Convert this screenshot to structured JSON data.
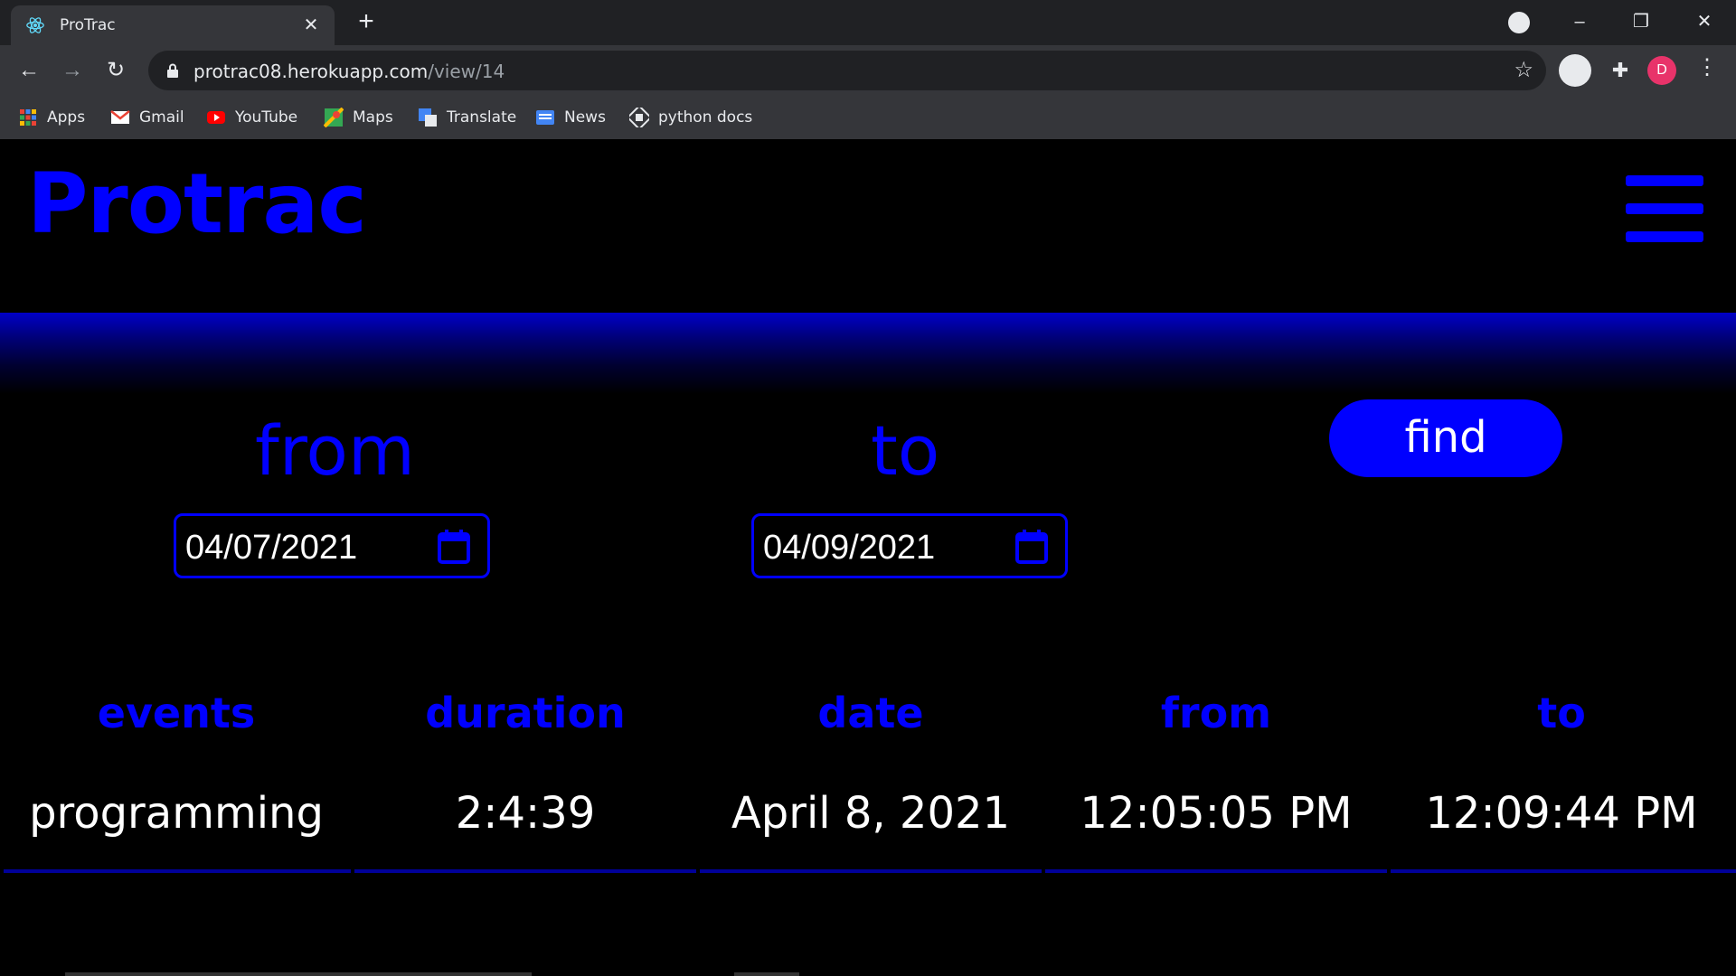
{
  "browser": {
    "tab_title": "ProTrac",
    "new_tab": "+",
    "close_tab": "✕",
    "url_host": "protrac08.herokuapp.com",
    "url_path": "/view/14",
    "profile_initial": "D",
    "bookmarks": [
      "Apps",
      "Gmail",
      "YouTube",
      "Maps",
      "Translate",
      "News",
      "python docs"
    ]
  },
  "header": {
    "logo": "Protrac"
  },
  "filter": {
    "from_label": "from",
    "to_label": "to",
    "from_date": "04/07/2021",
    "to_date": "04/09/2021",
    "find_label": "find"
  },
  "table": {
    "columns": [
      "events",
      "duration",
      "date",
      "from",
      "to"
    ],
    "rows": [
      [
        "programming",
        "2:4:39",
        "April 8, 2021",
        "12:05:05 PM",
        "12:09:44 PM"
      ]
    ]
  },
  "colors": {
    "accent": "#0000ff",
    "background": "#000000",
    "text": "#ffffff"
  }
}
